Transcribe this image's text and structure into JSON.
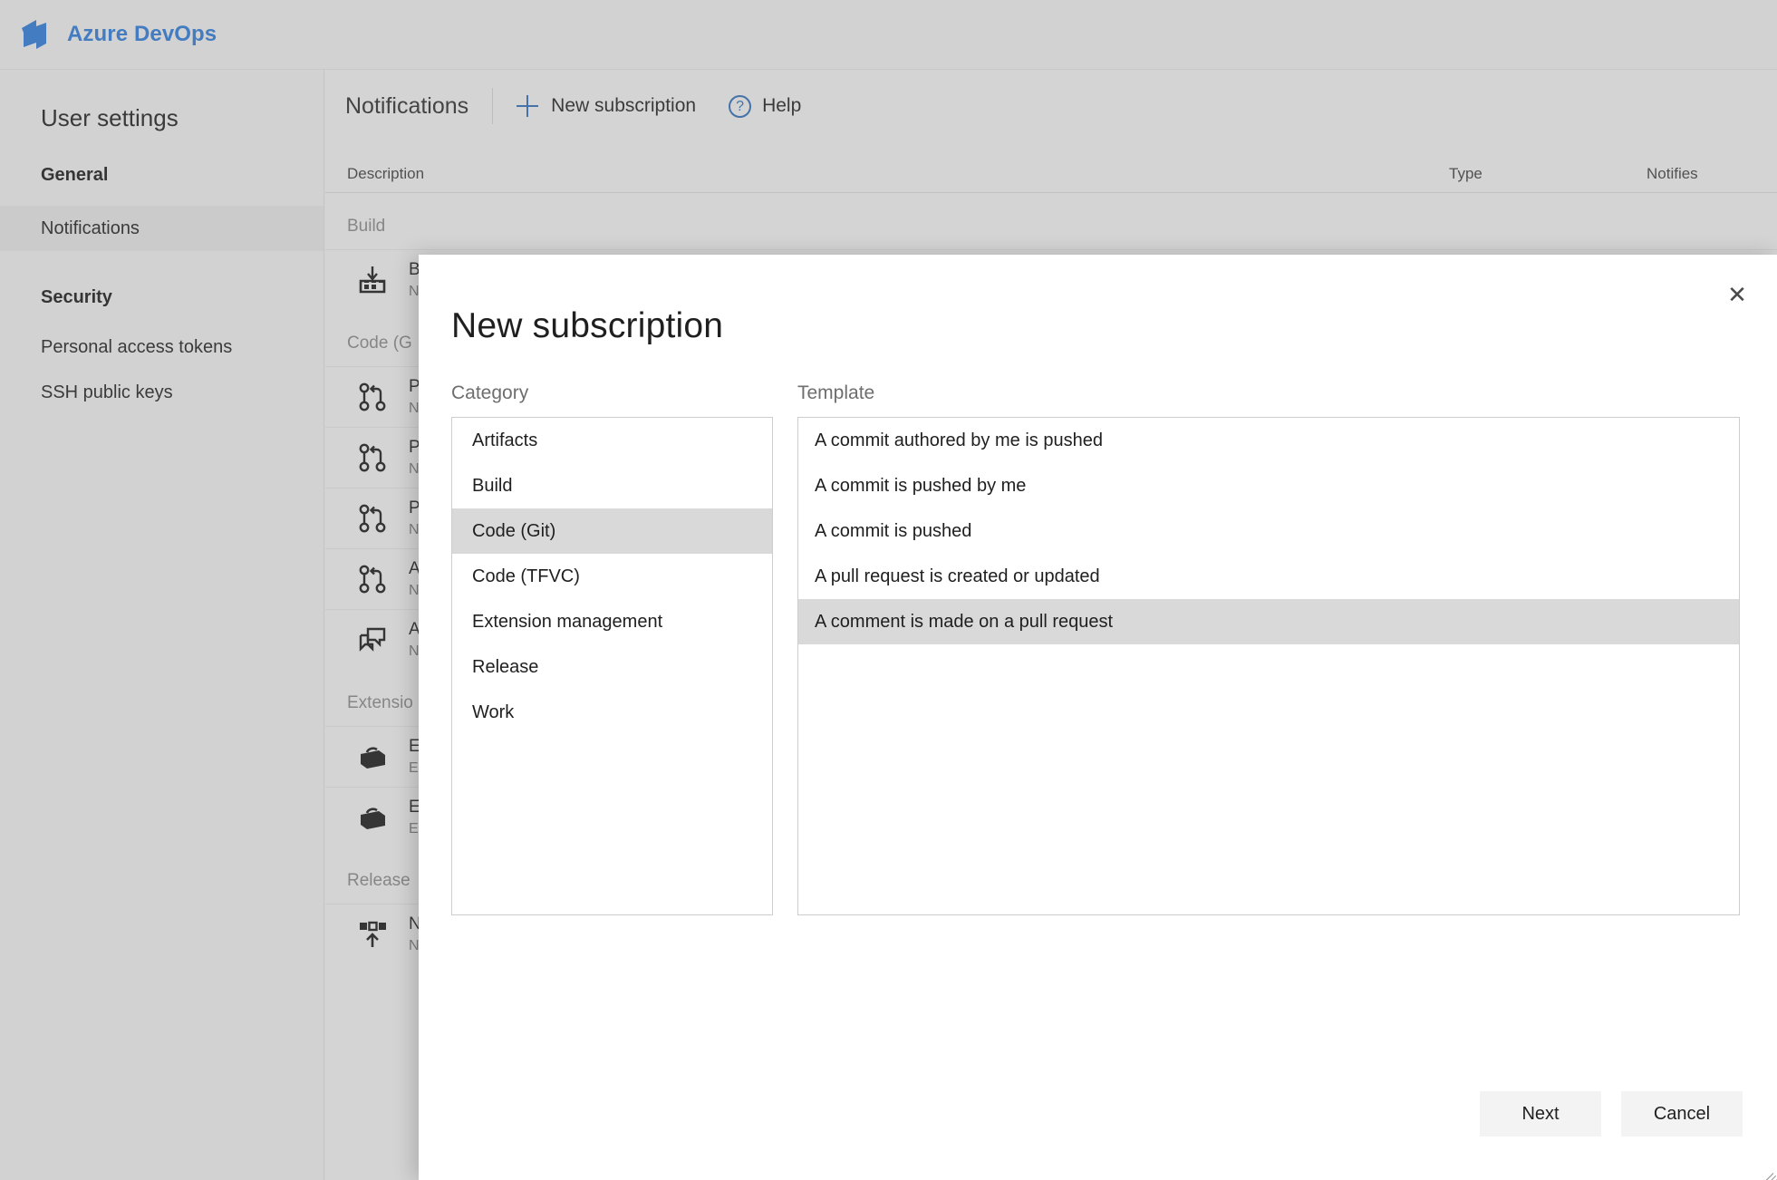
{
  "topbar": {
    "brand": "Azure DevOps",
    "logo_icon": "azure-devops-logo-icon"
  },
  "sidebar": {
    "title": "User settings",
    "general_label": "General",
    "notifications_label": "Notifications",
    "security_label": "Security",
    "pat_label": "Personal access tokens",
    "ssh_label": "SSH public keys"
  },
  "commandbar": {
    "page_title": "Notifications",
    "new_subscription_label": "New subscription",
    "new_subscription_icon": "plus-icon",
    "help_label": "Help",
    "help_icon": "question-circle-icon"
  },
  "table": {
    "col_description": "Description",
    "col_type": "Type",
    "col_notifies": "Notifies",
    "groups": [
      {
        "label": "Build",
        "rows": [
          {
            "icon": "build-icon",
            "title": "B",
            "subtitle": "N"
          }
        ]
      },
      {
        "label": "Code (G",
        "rows": [
          {
            "icon": "pull-request-icon",
            "title": "P",
            "subtitle": "N"
          },
          {
            "icon": "pull-request-icon",
            "title": "P",
            "subtitle": "N"
          },
          {
            "icon": "pull-request-icon",
            "title": "P",
            "subtitle": "N"
          },
          {
            "icon": "pull-request-icon",
            "title": "A",
            "subtitle": "N"
          },
          {
            "icon": "comment-icon",
            "title": "A",
            "subtitle": "N"
          }
        ]
      },
      {
        "label": "Extensio",
        "rows": [
          {
            "icon": "extension-icon",
            "title": "E",
            "subtitle": "E"
          },
          {
            "icon": "extension-icon",
            "title": "E",
            "subtitle": "E"
          }
        ]
      },
      {
        "label": "Release",
        "rows": [
          {
            "icon": "deployment-icon",
            "title": "N",
            "subtitle": "N"
          }
        ]
      }
    ]
  },
  "modal": {
    "title": "New subscription",
    "close_icon": "close-icon",
    "category_label": "Category",
    "template_label": "Template",
    "categories": [
      "Artifacts",
      "Build",
      "Code (Git)",
      "Code (TFVC)",
      "Extension management",
      "Release",
      "Work"
    ],
    "selected_category": "Code (Git)",
    "templates": [
      "A commit authored by me is pushed",
      "A commit is pushed by me",
      "A commit is pushed",
      "A pull request is created or updated",
      "A comment is made on a pull request"
    ],
    "selected_template": "A comment is made on a pull request",
    "next_label": "Next",
    "cancel_label": "Cancel"
  },
  "colors": {
    "brand_blue": "#2a6ab8",
    "selection_gray": "#d9d9d9",
    "chrome_gray": "#cccccc"
  }
}
